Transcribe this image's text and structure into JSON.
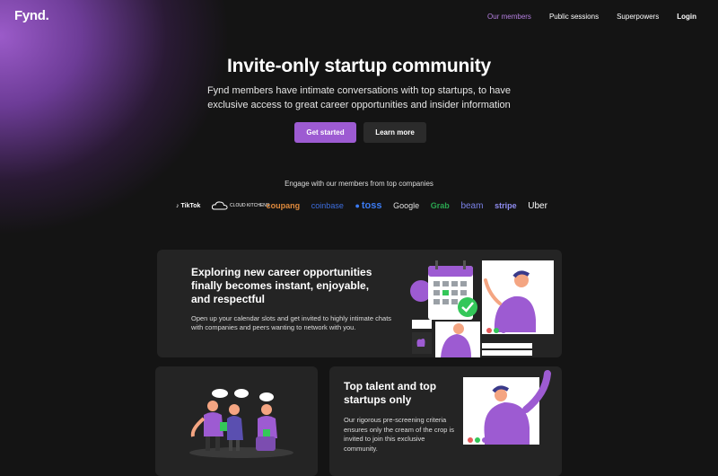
{
  "nav": {
    "logo": "Fynd.",
    "links": [
      "Our members",
      "Public sessions",
      "Superpowers",
      "Login"
    ],
    "active": "Our members"
  },
  "hero": {
    "title": "Invite-only startup community",
    "subtitle": "Fynd members have intimate conversations with top startups, to have exclusive access to great career opportunities and insider information",
    "primary_button": "Get started",
    "secondary_button": "Learn more"
  },
  "companies": {
    "heading": "Engage with our members from top companies",
    "logos": [
      "TikTok",
      "CLOUD KITCHENS",
      "coupang",
      "coinbase",
      "toss",
      "Google",
      "Grab",
      "beam",
      "stripe",
      "Uber"
    ]
  },
  "feature1": {
    "title": "Exploring new career opportunities finally becomes instant, enjoyable, and respectful",
    "body": "Open up your calendar slots and get invited to highly intimate chats with companies and peers wanting to network with you."
  },
  "feature3": {
    "title": "Top talent and top startups only",
    "body": "Our rigorous pre-screening criteria ensures only the cream of the crop is invited to join this exclusive community."
  },
  "colors": {
    "accent": "#9d5bd2",
    "background": "#141414",
    "card": "#242424"
  }
}
